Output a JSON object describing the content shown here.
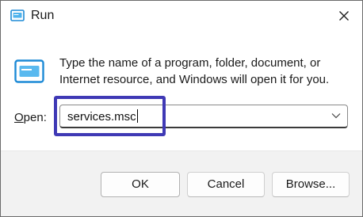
{
  "window": {
    "title": "Run",
    "icon": "run-dialog-icon"
  },
  "body": {
    "description": "Type the name of a program, folder, document, or Internet resource, and Windows will open it for you.",
    "open_label_prefix": "O",
    "open_label_rest": "pen:",
    "open_value": "services.msc"
  },
  "buttons": {
    "ok": "OK",
    "cancel": "Cancel",
    "browse": "Browse..."
  },
  "colors": {
    "highlight": "#3f39b5",
    "footer_bg": "#f2f2f2",
    "icon_blue": "#1d8ad6"
  }
}
